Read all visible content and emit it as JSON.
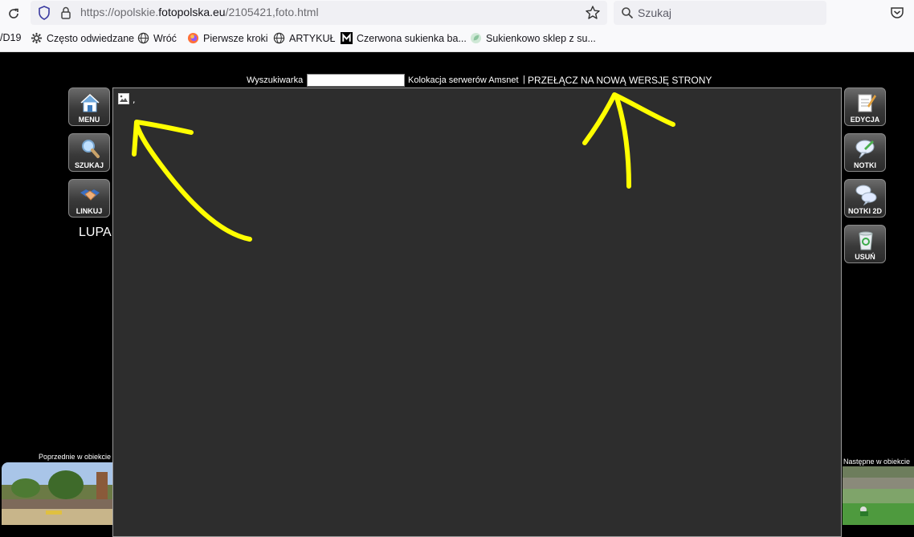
{
  "browser": {
    "url_prefix": "https://opolskie.",
    "url_domain": "fotopolska.eu",
    "url_suffix": "/2105421,foto.html",
    "search_placeholder": "Szukaj",
    "bookmarks": [
      {
        "label": "/D19",
        "icon": "none"
      },
      {
        "label": "Często odwiedzane",
        "icon": "gear-icon"
      },
      {
        "label": "Wróć",
        "icon": "globe-icon"
      },
      {
        "label": "Pierwsze kroki",
        "icon": "firefox-icon"
      },
      {
        "label": "ARTYKUŁ",
        "icon": "globe-icon"
      },
      {
        "label": "Czerwona sukienka ba...",
        "icon": "m-logo-icon"
      },
      {
        "label": "Sukienkowo sklep z su...",
        "icon": "leaf-icon"
      }
    ]
  },
  "page": {
    "search_label": "Wyszukiwarka",
    "search_value": "",
    "colocation_link": "Kolokacja serwerów Amsnet",
    "separator": "|",
    "new_version_link": "PRZEŁĄCZ NA NOWĄ WERSJĘ STRONY",
    "left_buttons": [
      {
        "label": "MENU",
        "icon": "home-icon"
      },
      {
        "label": "SZUKAJ",
        "icon": "magnifier-icon"
      },
      {
        "label": "LINKUJ",
        "icon": "handshake-icon"
      }
    ],
    "right_buttons": [
      {
        "label": "EDYCJA",
        "icon": "notepad-icon"
      },
      {
        "label": "NOTKI",
        "icon": "speech-bubble-icon"
      },
      {
        "label": "NOTKI 2D",
        "icon": "speech-bubbles-icon"
      },
      {
        "label": "USUŃ",
        "icon": "recycle-bin-icon"
      }
    ],
    "lupa_label": "LUPA",
    "viewer_caption": ",",
    "prev_label": "Poprzednie w obiekcie",
    "next_label": "Następne w obiekcie"
  },
  "colors": {
    "page_bg": "#000000",
    "viewer_bg": "#2d2d2d",
    "annotation": "#ffff00"
  }
}
